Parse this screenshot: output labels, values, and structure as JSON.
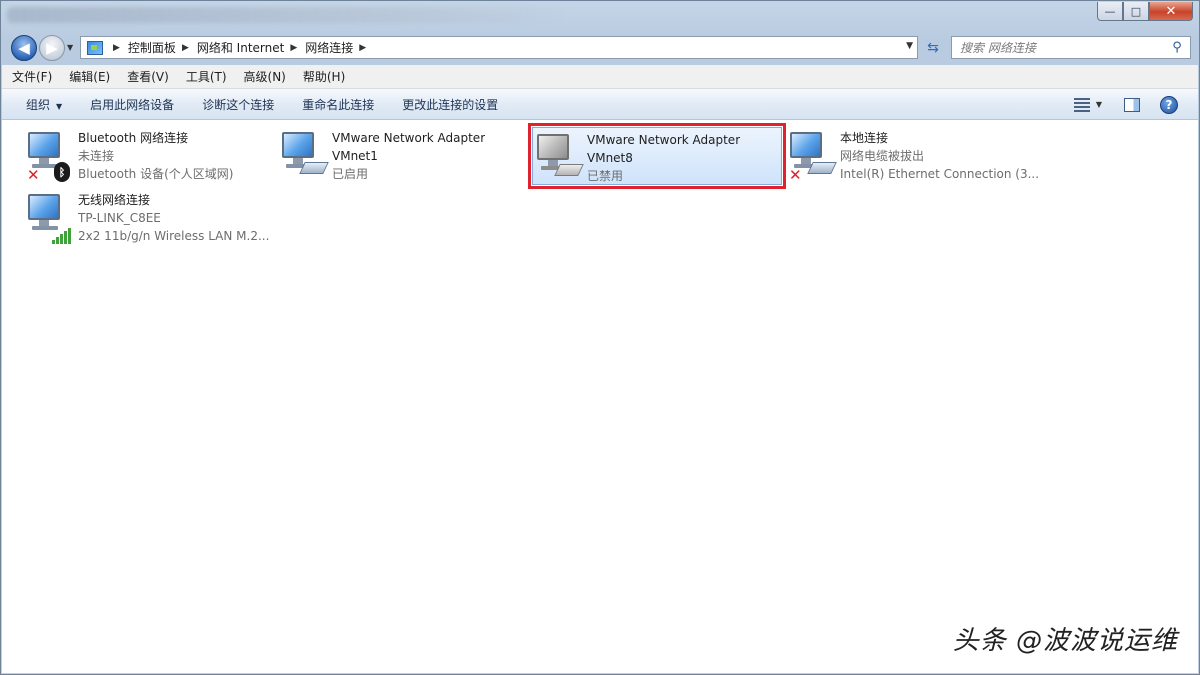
{
  "window": {
    "controls": {
      "minimize": "—",
      "maximize": "□",
      "close": "✕"
    }
  },
  "address": {
    "breadcrumbs": [
      "控制面板",
      "网络和 Internet",
      "网络连接"
    ],
    "search_placeholder": "搜索 网络连接"
  },
  "menu": [
    "文件(F)",
    "编辑(E)",
    "查看(V)",
    "工具(T)",
    "高级(N)",
    "帮助(H)"
  ],
  "commands": {
    "organize": "组织",
    "enable": "启用此网络设备",
    "diagnose": "诊断这个连接",
    "rename": "重命名此连接",
    "change": "更改此连接的设置"
  },
  "connections": [
    {
      "name": "Bluetooth 网络连接",
      "line2": "未连接",
      "line3": "Bluetooth 设备(个人区域网)",
      "icon": "bluetooth-icon"
    },
    {
      "name": "VMware Network Adapter",
      "line2": "VMnet1",
      "line3": "已启用",
      "icon": "network-cable-icon"
    },
    {
      "name": "VMware Network Adapter",
      "line2": "VMnet8",
      "line3": "已禁用",
      "icon": "network-cable-icon"
    },
    {
      "name": "本地连接",
      "line2": "网络电缆被拔出",
      "line3": "Intel(R) Ethernet Connection (3...",
      "icon": "network-cable-icon"
    },
    {
      "name": "无线网络连接",
      "line2": "TP-LINK_C8EE",
      "line3": "2x2 11b/g/n Wireless LAN M.2...",
      "icon": "wifi-signal-icon"
    }
  ],
  "watermark": "头条 @波波说运维",
  "colors": {
    "highlight": "#e0222e",
    "selection": "#cfe3fb"
  }
}
